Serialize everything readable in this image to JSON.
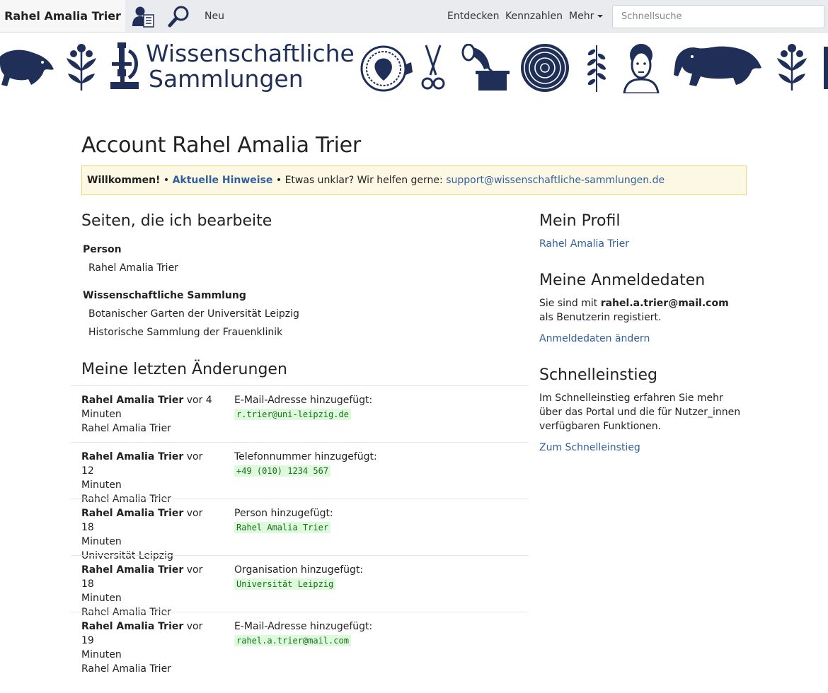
{
  "navbar": {
    "brand": "Rahel Amalia Trier",
    "new_label": "Neu",
    "discover_label": "Entdecken",
    "figures_label": "Kennzahlen",
    "more_label": "Mehr",
    "search_placeholder": "Schnellsuche",
    "icons": [
      "user-list-icon",
      "search-icon",
      "chevron-down-icon"
    ]
  },
  "banner": {
    "title_line1": "Wissenschaftliche",
    "title_line2": "Sammlungen",
    "icons": [
      "seal-icon",
      "plant-icon",
      "microscope-icon",
      "coin-icon",
      "scissors-icon",
      "gramophone-icon",
      "ammonite-icon",
      "leaf-icon",
      "bust-icon",
      "horse-icon"
    ],
    "color": "#1f2f57"
  },
  "page": {
    "title": "Account Rahel Amalia Trier"
  },
  "alert": {
    "welcome": "Willkommen!",
    "sep1": " • ",
    "notices_link": "Aktuelle Hinweise",
    "sep2": " • ",
    "help_text": "Etwas unklar? Wir helfen gerne: ",
    "email_link": "support@wissenschaftliche-sammlungen.de"
  },
  "pages_section": {
    "heading": "Seiten, die ich bearbeite",
    "groups": [
      {
        "label": "Person",
        "items": [
          "Rahel Amalia Trier"
        ]
      },
      {
        "label": "Wissenschaftliche Sammlung",
        "items": [
          "Botanischer Garten der Universität Leipzig",
          "Historische Sammlung der Frauenklinik"
        ]
      }
    ]
  },
  "changes_section": {
    "heading": "Meine letzten Änderungen",
    "rows": [
      {
        "author": "Rahel Amalia Trier",
        "time_a": " vor 4",
        "time_b": "Minuten",
        "target": "Rahel Amalia Trier",
        "action": "E-Mail-Adresse hinzugefügt:",
        "value": "r.trier@uni-leipzig.de"
      },
      {
        "author": "Rahel Amalia Trier",
        "time_a": " vor 12",
        "time_b": "Minuten",
        "target": "Rahel Amalia Trier",
        "action": "Telefonnummer hinzugefügt:",
        "value": "+49 (010) 1234 567"
      },
      {
        "author": "Rahel Amalia Trier",
        "time_a": " vor 18",
        "time_b": "Minuten",
        "target": "Universität Leipzig",
        "action": "Person hinzugefügt:",
        "value": "Rahel Amalia Trier"
      },
      {
        "author": "Rahel Amalia Trier",
        "time_a": " vor 18",
        "time_b": "Minuten",
        "target": "Rahel Amalia Trier",
        "action": "Organisation hinzugefügt:",
        "value": "Universität Leipzig"
      },
      {
        "author": "Rahel Amalia Trier",
        "time_a": " vor 19",
        "time_b": "Minuten",
        "target": "Rahel Amalia Trier",
        "action": "E-Mail-Adresse hinzugefügt:",
        "value": "rahel.a.trier@mail.com"
      }
    ]
  },
  "sidebar": {
    "profile": {
      "heading": "Mein Profil",
      "link": "Rahel Amalia Trier"
    },
    "login": {
      "heading": "Meine Anmeldedaten",
      "text_before": "Sie sind mit ",
      "email": "rahel.a.trier@mail.com",
      "text_after": " als Benutzerin registiert.",
      "link": "Anmeldedaten ändern"
    },
    "quickstart": {
      "heading": "Schnelleinstieg",
      "text": "Im Schnelleinstieg erfahren Sie mehr über das Portal und die für Nutzer_innen verfügbaren Funktionen.",
      "link": "Zum Schnelleinstieg"
    }
  },
  "colors": {
    "link": "#2f5f9e",
    "alert_bg": "#fcf8e3",
    "alert_border": "#e8d87a",
    "code_bg": "#ddfbdc",
    "code_text": "#1c6b1c",
    "navbar_bg": "#e9ebee"
  }
}
